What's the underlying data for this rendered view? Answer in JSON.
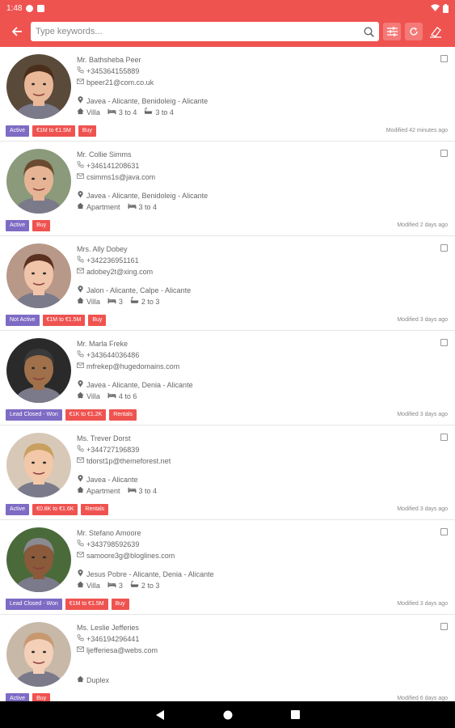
{
  "status_bar": {
    "time": "1:48"
  },
  "search": {
    "placeholder": "Type keywords..."
  },
  "contacts": [
    {
      "name": "Mr. Bathsheba Peer",
      "phone": "+345364155889",
      "email": "bpeer21@com.co.uk",
      "location": "Javea - Alicante, Benidoleig - Alicante",
      "type": "Villa",
      "beds": "3 to 4",
      "baths": "3 to 4",
      "tags": [
        {
          "label": "Active",
          "color": "purple"
        },
        {
          "label": "€1M to €1.5M",
          "color": "red"
        },
        {
          "label": "Buy",
          "color": "red"
        }
      ],
      "modified": "Modified 42 minutes ago",
      "avatar_skin": "#e8b898",
      "avatar_hair": "#4a2e1c",
      "avatar_bg": "#5a4a3a"
    },
    {
      "name": "Mr. Collie Simms",
      "phone": "+346141208631",
      "email": "csimms1s@java.com",
      "location": "Javea - Alicante, Benidoleig - Alicante",
      "type": "Apartment",
      "beds": "3 to 4",
      "baths": "",
      "tags": [
        {
          "label": "Active",
          "color": "purple"
        },
        {
          "label": "Buy",
          "color": "red"
        }
      ],
      "modified": "Modified 2 days ago",
      "avatar_skin": "#e6b494",
      "avatar_hair": "#6a4a30",
      "avatar_bg": "#8a9a7a"
    },
    {
      "name": "Mrs. Ally Dobey",
      "phone": "+342236951161",
      "email": "adobey2t@xing.com",
      "location": "Jalon - Alicante, Calpe - Alicante",
      "type": "Villa",
      "beds": "3",
      "baths": "2 to 3",
      "tags": [
        {
          "label": "Not Active",
          "color": "purple"
        },
        {
          "label": "€1M to €1.5M",
          "color": "red"
        },
        {
          "label": "Buy",
          "color": "red"
        }
      ],
      "modified": "Modified 3 days ago",
      "avatar_skin": "#f0c4a8",
      "avatar_hair": "#5a3020",
      "avatar_bg": "#b89888"
    },
    {
      "name": "Mr. Marla Freke",
      "phone": "+343644036486",
      "email": "mfrekep@hugedomains.com",
      "location": "Javea - Alicante, Denia - Alicante",
      "type": "Villa",
      "beds": "4 to 6",
      "baths": "",
      "tags": [
        {
          "label": "Lead Closed - Won",
          "color": "purple"
        },
        {
          "label": "€1K to €1.2K",
          "color": "red"
        },
        {
          "label": "Rentals",
          "color": "red"
        }
      ],
      "modified": "Modified 3 days ago",
      "avatar_skin": "#a0704a",
      "avatar_hair": "#3a3a3a",
      "avatar_bg": "#2a2a2a"
    },
    {
      "name": "Ms. Trever Dorst",
      "phone": "+344727196839",
      "email": "tdorst1p@themeforest.net",
      "location": "Javea - Alicante",
      "type": "Apartment",
      "beds": "3 to 4",
      "baths": "",
      "tags": [
        {
          "label": "Active",
          "color": "purple"
        },
        {
          "label": "€0.8K to €1.6K",
          "color": "red"
        },
        {
          "label": "Rentals",
          "color": "red"
        }
      ],
      "modified": "Modified 3 days ago",
      "avatar_skin": "#f2c8a8",
      "avatar_hair": "#c8a060",
      "avatar_bg": "#d8c8b8"
    },
    {
      "name": "Mr. Stefano Amoore",
      "phone": "+343798592639",
      "email": "samoore3g@bloglines.com",
      "location": "Jesus Pobre - Alicante, Denia - Alicante",
      "type": "Villa",
      "beds": "3",
      "baths": "2 to 3",
      "tags": [
        {
          "label": "Lead Closed - Won",
          "color": "purple"
        },
        {
          "label": "€1M to €1.5M",
          "color": "red"
        },
        {
          "label": "Buy",
          "color": "red"
        }
      ],
      "modified": "Modified 3 days ago",
      "avatar_skin": "#8a5a3a",
      "avatar_hair": "#8a8a90",
      "avatar_bg": "#4a6a3a"
    },
    {
      "name": "Ms. Leslie Jefferies",
      "phone": "+346194296441",
      "email": "ljefferiesa@webs.com",
      "location": "",
      "type": "Duplex",
      "beds": "",
      "baths": "",
      "tags": [
        {
          "label": "Active",
          "color": "purple"
        },
        {
          "label": "Buy",
          "color": "red"
        }
      ],
      "modified": "Modified 6 days ago",
      "avatar_skin": "#f4d0b8",
      "avatar_hair": "#c89870",
      "avatar_bg": "#c8b8a8"
    }
  ]
}
